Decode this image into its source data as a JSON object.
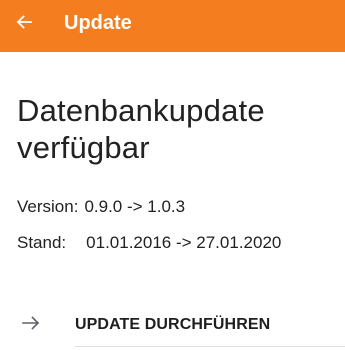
{
  "app_bar": {
    "title": "Update",
    "back_icon": "arrow-left-icon",
    "color": "#f47d20"
  },
  "content": {
    "headline_line1": "Datenbankupdate",
    "headline_line2": "verfügbar",
    "version_label": "Version:",
    "version_value": "0.9.0 -> 1.0.3",
    "stand_label": "Stand:",
    "stand_value": "01.01.2016 -> 27.01.2020"
  },
  "action": {
    "icon": "arrow-right-icon",
    "label": "UPDATE DURCHFÜHREN"
  }
}
